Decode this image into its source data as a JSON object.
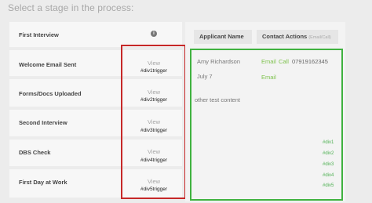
{
  "page": {
    "title": "Select a stage in the process:"
  },
  "stages": [
    {
      "label": "First Interview"
    },
    {
      "label": "Welcome Email Sent",
      "view": "View",
      "trigger": "#div1trigger"
    },
    {
      "label": "Forms/Docs Uploaded",
      "view": "View",
      "trigger": "#div2trigger"
    },
    {
      "label": "Second Interview",
      "view": "View",
      "trigger": "#div3trigger"
    },
    {
      "label": "DBS Check",
      "view": "View",
      "trigger": "#div4trigger"
    },
    {
      "label": "First Day at Work",
      "view": "View",
      "trigger": "#div5trigger"
    }
  ],
  "details": {
    "headers": {
      "applicant_name": "Applicant Name",
      "contact_actions": "Contact Actions",
      "contact_hint": "(Email/Call)"
    },
    "applicant": {
      "name": "Amy Richardson",
      "email_link": "Email",
      "call_link": "Call",
      "phone": "07919162345",
      "date": "July 7",
      "date_email_link": "Email",
      "note": "other test content"
    },
    "div_tags": [
      "#div1",
      "#div2",
      "#div3",
      "#div4",
      "#div5"
    ]
  },
  "icons": {
    "info": "info-icon"
  },
  "colors": {
    "highlight_red": "#c62828",
    "highlight_green": "#3fb23f",
    "link_green": "#7ec24d"
  }
}
